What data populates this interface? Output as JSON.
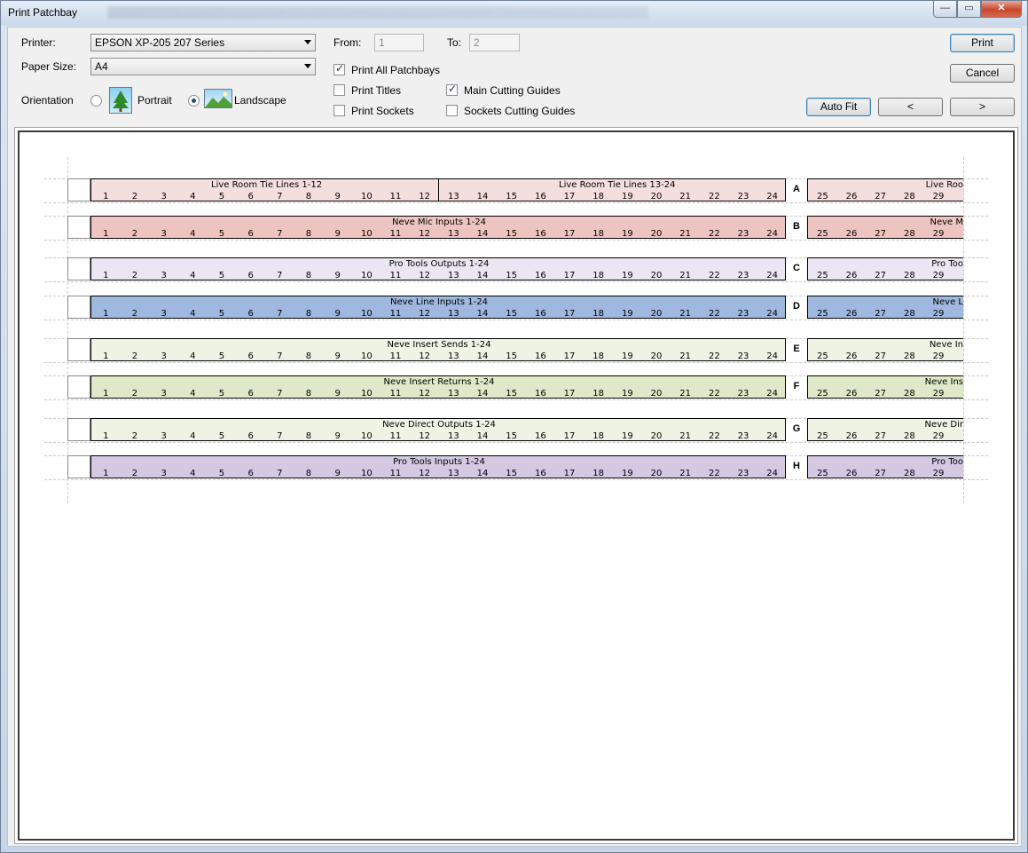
{
  "window": {
    "title": "Print Patchbay",
    "min": "—",
    "max": "▭",
    "close": "✕"
  },
  "form": {
    "printer_label": "Printer:",
    "printer_value": "EPSON XP-205 207 Series",
    "paper_label": "Paper Size:",
    "paper_value": "A4",
    "orientation_label": "Orientation",
    "portrait_label": "Portrait",
    "landscape_label": "Landscape",
    "from_label": "From:",
    "from_value": "1",
    "to_label": "To:",
    "to_value": "2",
    "print_all": {
      "label": "Print All Patchbays",
      "checked": true
    },
    "print_titles": {
      "label": "Print Titles",
      "checked": false
    },
    "print_sockets": {
      "label": "Print Sockets",
      "checked": false
    },
    "main_guides": {
      "label": "Main Cutting Guides",
      "checked": true
    },
    "socket_guides": {
      "label": "Sockets Cutting Guides",
      "checked": false
    }
  },
  "buttons": {
    "print": "Print",
    "cancel": "Cancel",
    "autofit": "Auto Fit",
    "prev": "<",
    "next": ">"
  },
  "patchbay": {
    "rows": [
      {
        "letter": "A",
        "color": "#f5dede",
        "titles": [
          "Live Room Tie Lines 1-12",
          "Live Room Tie Lines 13-24"
        ],
        "split": true,
        "page2_title": "Live Roo"
      },
      {
        "letter": "B",
        "color": "#eec4c0",
        "titles": [
          "Neve Mic Inputs 1-24"
        ],
        "split": false,
        "page2_title": "Neve M"
      },
      {
        "letter": "C",
        "color": "#ece6f2",
        "titles": [
          "Pro Tools Outputs 1-24"
        ],
        "split": false,
        "page2_title": "Pro Too"
      },
      {
        "letter": "D",
        "color": "#9fb8df",
        "titles": [
          "Neve Line Inputs 1-24"
        ],
        "split": false,
        "page2_title": "Neve L"
      },
      {
        "letter": "E",
        "color": "#eef3e4",
        "titles": [
          "Neve Insert Sends 1-24"
        ],
        "split": false,
        "page2_title": "Neve In"
      },
      {
        "letter": "F",
        "color": "#dde9c8",
        "titles": [
          "Neve Insert Returns 1-24"
        ],
        "split": false,
        "page2_title": "Neve Ins"
      },
      {
        "letter": "G",
        "color": "#eef3e4",
        "titles": [
          "Neve Direct Outputs 1-24"
        ],
        "split": false,
        "page2_title": "Neve Dir"
      },
      {
        "letter": "H",
        "color": "#d5c8e3",
        "titles": [
          "Pro Tools Inputs 1-24"
        ],
        "split": false,
        "page2_title": "Pro Too"
      }
    ],
    "page2_numbers": [
      "25",
      "26",
      "27",
      "28",
      "29",
      "3"
    ]
  }
}
